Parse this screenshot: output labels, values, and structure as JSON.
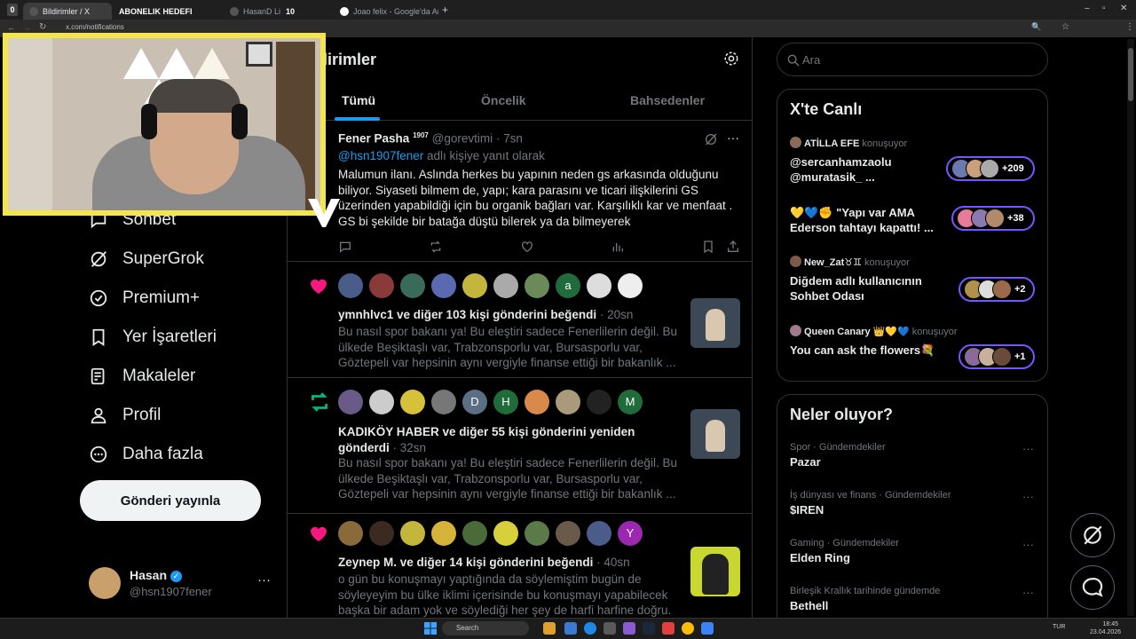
{
  "browser": {
    "tabs": [
      {
        "label": "Bildirimler / X"
      },
      {
        "label": "ABONELIK HEDEFI"
      },
      {
        "label": "HasanD Link Dnh"
      },
      {
        "label": "10"
      },
      {
        "label": "Joao felix - Google'da Ara"
      }
    ],
    "tab_counter": "0",
    "url": "x.com/notifications",
    "new_tab": "+"
  },
  "sidebar": {
    "items": [
      {
        "label": "Sohbet",
        "icon": "chat-bubble-icon"
      },
      {
        "label": "SuperGrok",
        "icon": "grok-icon"
      },
      {
        "label": "Premium+",
        "icon": "verified-badge-icon"
      },
      {
        "label": "Yer İşaretleri",
        "icon": "bookmark-icon"
      },
      {
        "label": "Makaleler",
        "icon": "article-icon"
      },
      {
        "label": "Profil",
        "icon": "person-icon"
      },
      {
        "label": "Daha fazla",
        "icon": "more-circle-icon"
      }
    ],
    "post_button": "Gönderi yayınla",
    "profile": {
      "name": "Hasan",
      "handle": "@hsn1907fener",
      "more": "···"
    }
  },
  "main": {
    "title": "dirimler",
    "tabs": [
      {
        "label": "Tümü"
      },
      {
        "label": "Öncelik"
      },
      {
        "label": "Bahsedenler"
      }
    ],
    "reply": {
      "author": "Fener Pasha",
      "author_sup": "1907",
      "handle": "@gorevtimi",
      "time": "· 7sn",
      "reply_to_handle": "@hsn1907fener",
      "reply_to_suffix": " adlı kişiye yanıt olarak",
      "text": "Malumun ilanı. Aslında herkes bu yapının neden gs arkasında olduğunu biliyor. Siyaseti bilmem de, yapı; kara parasını ve ticari ilişkilerini GS üzerinden yapabildiği için bu organik bağları var. Karşılıklı kar ve menfaat . GS bi şekilde bir batağa düştü bilerek ya da bilmeyerek"
    },
    "notifications": [
      {
        "type": "like",
        "actor": "ymnhlvc1",
        "action": " ve diğer 103 kişi gönderini beğendi",
        "time": "· 20sn",
        "text": "Bu nasıl spor bakanı ya! Bu eleştiri sadece Fenerlilerin değil. Bu ülkede Beşiktaşlı var, Trabzonsporlu var, Bursasporlu var, Göztepeli var  hepsinin aynı vergiyle finanse ettiği bir bakanlık ...",
        "letters": [
          "a"
        ]
      },
      {
        "type": "repost",
        "actor": "KADIKÖY HABER",
        "action": " ve diğer 55 kişi gönderini yeniden gönderdi",
        "time": "· 32sn",
        "text": "Bu nasıl spor bakanı ya! Bu eleştiri sadece Fenerlilerin değil. Bu ülkede Beşiktaşlı var, Trabzonsporlu var, Bursasporlu var, Göztepeli var  hepsinin aynı vergiyle finanse ettiği bir bakanlık ...",
        "letters": [
          "D",
          "H",
          "M"
        ]
      },
      {
        "type": "like",
        "actor": "Zeynep M.",
        "action": " ve diğer 14 kişi gönderini beğendi",
        "time": "· 40sn",
        "text": "o gün bu konuşmayı yaptığında da söylemiştim bugün de söyleyeyim bu ülke iklimi içerisinde bu konuşmayı yapabilecek başka bir adam yok ve söylediği her şey de harfi harfine doğru.",
        "letters": [
          "Y"
        ]
      }
    ]
  },
  "right": {
    "search_placeholder": "Ara",
    "live": {
      "title": "X'te Canlı",
      "items": [
        {
          "host": "ATİLLA EFE",
          "status": "konuşuyor",
          "title": "@sercanhamzaolu @muratasik_ ...",
          "count": "+209"
        },
        {
          "host": "",
          "status": "",
          "title": "💛💙✊ \"Yapı var AMA Ederson tahtayı kapattı! ...",
          "count": "+38"
        },
        {
          "host": "New_Zat♉♊",
          "status": "konuşuyor",
          "title": "Diğdem adlı kullanıcının Sohbet Odası",
          "count": "+2"
        },
        {
          "host": "Queen Canary 👑💛💙",
          "status": "konuşuyor",
          "title": "You can ask the flowers💐",
          "count": "+1"
        }
      ]
    },
    "trends": {
      "title": "Neler oluyor?",
      "items": [
        {
          "category": "Spor · Gündemdekiler",
          "name": "Pazar"
        },
        {
          "category": "İş dünyası ve finans · Gündemdekiler",
          "name": "$IREN"
        },
        {
          "category": "Gaming · Gündemdekiler",
          "name": "Elden Ring"
        },
        {
          "category": "Birleşik Krallık tarihinde gündemde",
          "name": "Bethell"
        }
      ]
    }
  },
  "taskbar": {
    "search": "Search",
    "lang": "TUR",
    "time": "18:45",
    "date": "23.04.2026"
  },
  "colors": {
    "accent_blue": "#1d9bf0",
    "like_pink": "#f91880",
    "repost_green": "#00ba7c",
    "live_purple": "#7856ff",
    "cam_border": "#f3e54a"
  }
}
